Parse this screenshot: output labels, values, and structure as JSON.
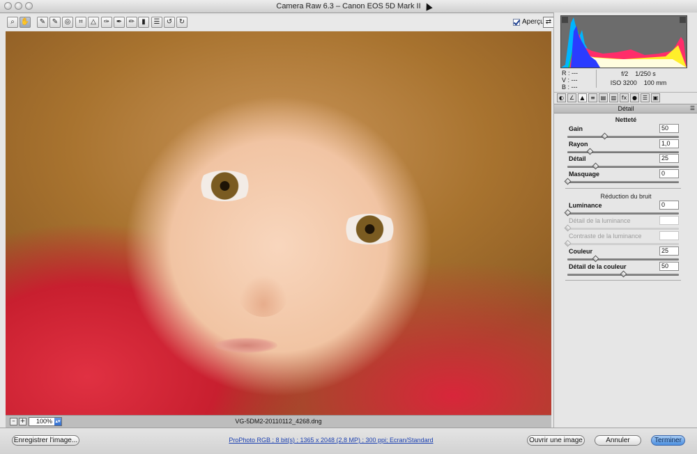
{
  "window": {
    "title": "Camera Raw 6.3  –  Canon EOS 5D Mark II"
  },
  "toolbar": {
    "tools": [
      {
        "name": "zoom-tool",
        "glyph": "🔍"
      },
      {
        "name": "hand-tool",
        "glyph": "✋"
      },
      {
        "name": "white-balance-tool",
        "glyph": "✎"
      },
      {
        "name": "color-sampler-tool",
        "glyph": "✎"
      },
      {
        "name": "targeted-adjustment-tool",
        "glyph": "◎"
      },
      {
        "name": "crop-tool",
        "glyph": "⌗"
      },
      {
        "name": "straighten-tool",
        "glyph": "△"
      },
      {
        "name": "spot-removal-tool",
        "glyph": "✎"
      },
      {
        "name": "red-eye-tool",
        "glyph": "✎"
      },
      {
        "name": "adjustment-brush-tool",
        "glyph": "✎"
      },
      {
        "name": "graduated-filter-tool",
        "glyph": "▮"
      },
      {
        "name": "preferences-tool",
        "glyph": "☰"
      },
      {
        "name": "rotate-left-tool",
        "glyph": "↺"
      },
      {
        "name": "rotate-right-tool",
        "glyph": "↻"
      }
    ],
    "preview_label": "Aperçu",
    "preview_checked": true
  },
  "image": {
    "filename": "VG-5DM2-20110112_4268.dng"
  },
  "zoom": {
    "minus": "–",
    "plus": "+",
    "value": "100%"
  },
  "info": {
    "r_label": "R :",
    "r_value": "---",
    "v_label": "V :",
    "v_value": "---",
    "b_label": "B :",
    "b_value": "---",
    "aperture": "f/2",
    "shutter": "1/250 s",
    "iso": "ISO 3200",
    "focal": "100 mm"
  },
  "panel": {
    "title": "Détail",
    "sharpening": {
      "title": "Netteté",
      "sliders": [
        {
          "label": "Gain",
          "value": "50",
          "level": 0.33,
          "enabled": true
        },
        {
          "label": "Rayon",
          "value": "1,0",
          "level": 0.2,
          "enabled": true
        },
        {
          "label": "Détail",
          "value": "25",
          "level": 0.25,
          "enabled": true
        },
        {
          "label": "Masquage",
          "value": "0",
          "level": 0.0,
          "enabled": true
        }
      ]
    },
    "noise": {
      "title": "Réduction du bruit",
      "sliders": [
        {
          "label": "Luminance",
          "value": "0",
          "level": 0.0,
          "enabled": true
        },
        {
          "label": "Détail de la luminance",
          "value": "",
          "level": 0.0,
          "enabled": false
        },
        {
          "label": "Contraste de la luminance",
          "value": "",
          "level": 0.0,
          "enabled": false
        },
        {
          "label": "Couleur",
          "value": "25",
          "level": 0.25,
          "enabled": true
        },
        {
          "label": "Détail de la couleur",
          "value": "50",
          "level": 0.5,
          "enabled": true
        }
      ]
    }
  },
  "footer": {
    "save_label": "Enregistrer l'image...",
    "workflow_link": "ProPhoto RGB ; 8 bit(s) ; 1365 x 2048 (2,8 MP) ; 300 ppi; Ecran/Standard",
    "open_label": "Ouvrir une image",
    "cancel_label": "Annuler",
    "done_label": "Terminer"
  }
}
